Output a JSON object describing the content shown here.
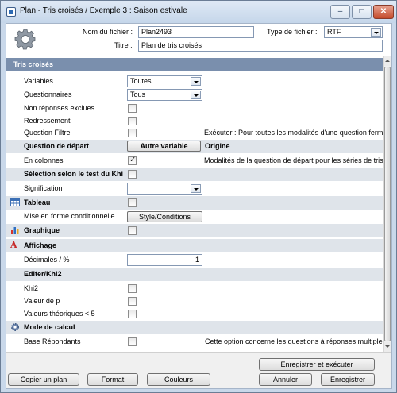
{
  "window": {
    "title": "Plan - Tris croisés / Exemple 3 : Saison estivale",
    "minimize": "–",
    "maximize": "□",
    "close": "✕"
  },
  "header": {
    "filename_label": "Nom du fichier :",
    "filename_value": "Plan2493",
    "filetype_label": "Type de fichier :",
    "filetype_value": "RTF",
    "title_label": "Titre :",
    "title_value": "Plan de tris croisés",
    "icon": "gear-icon"
  },
  "sections": {
    "tris_croises": "Tris croisés",
    "question_depart": "Question de départ",
    "selection_khi": "Sélection selon le test du Khi",
    "tableau": "Tableau",
    "graphique": "Graphique",
    "affichage": "Affichage",
    "editer_khi2": "Editer/Khi2",
    "mode_calcul": "Mode de calcul"
  },
  "rows": {
    "variables_label": "Variables",
    "variables_value": "Toutes",
    "questionnaires_label": "Questionnaires",
    "questionnaires_value": "Tous",
    "non_reponses_label": "Non réponses exclues",
    "redressement_label": "Redressement",
    "question_filtre_label": "Question Filtre",
    "question_filtre_info": "Exécuter : Pour toutes les modalités d'une question fermée",
    "autre_variable_button": "Autre variable",
    "origine_label": "Origine",
    "en_colonnes_label": "En colonnes",
    "en_colonnes_info": "Modalités de la question de départ pour les séries de tris croisés",
    "signification_label": "Signification",
    "mise_en_forme_label": "Mise en forme conditionnelle",
    "style_conditions_button": "Style/Conditions",
    "decimales_label": "Décimales / %",
    "decimales_value": "1",
    "khi2_label": "Khi2",
    "valeur_p_label": "Valeur de p",
    "valeurs_theoriques_label": "Valeurs théoriques < 5",
    "base_repondants_label": "Base Répondants",
    "base_repondants_info": "Cette option concerne les questions à réponses multiples"
  },
  "checks": {
    "en_colonnes": true
  },
  "footer": {
    "copier_plan": "Copier un plan",
    "format": "Format",
    "couleurs": "Couleurs",
    "enregistrer_executer": "Enregistrer et exécuter",
    "annuler": "Annuler",
    "enregistrer": "Enregistrer"
  },
  "colors": {
    "section_main_bg": "#7a8fad",
    "section_bg": "#dfe4ea",
    "window_frame": "#c9d8ea"
  }
}
